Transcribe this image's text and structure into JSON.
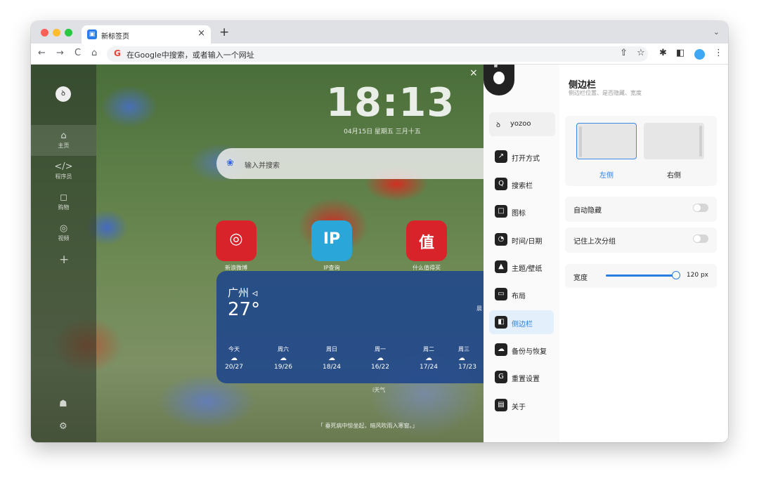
{
  "browser": {
    "tab_title": "新标签页",
    "tab_close": "×",
    "new_tab": "+",
    "tab_dropdown": "⌄",
    "back": "←",
    "forward": "→",
    "reload": "C",
    "home": "⌂",
    "google_letter": "G",
    "address_placeholder": "在Google中搜索，或者输入一个网址",
    "share": "⇧",
    "bookmark": "☆",
    "extensions": "✱",
    "sidebar_toggle": "◧",
    "menu": "⋮"
  },
  "sidebar": {
    "logo": "ꝺ",
    "items": [
      {
        "icon": "⌂",
        "label": "主页"
      },
      {
        "icon": "</>",
        "label": "程序员"
      },
      {
        "icon": "◻",
        "label": "购物"
      },
      {
        "icon": "◎",
        "label": "视频"
      }
    ],
    "add": "+",
    "bottom_icon_1": "☗",
    "bottom_icon_2": "⚙"
  },
  "main": {
    "time": "18:13",
    "close": "×",
    "date": "04月15日 星期五 三月十五",
    "search_icon": "❀",
    "search_placeholder": "输入并搜索",
    "apps": [
      {
        "label": "新浪微博",
        "icon": "◎",
        "color": "#d8232a"
      },
      {
        "label": "IP查询",
        "icon": "IP",
        "color": "#2aa6d9"
      },
      {
        "label": "什么值得买",
        "icon": "值",
        "color": "#d8232a"
      }
    ],
    "poem": "「 垂死病中惊坐起，暗风吹雨入寒窗。」"
  },
  "weather": {
    "city": "广州 ◃",
    "temp": "27°",
    "edge": "晨",
    "source": "i天气",
    "days": [
      {
        "name": "今天",
        "icon": "☁",
        "range": "20/27"
      },
      {
        "name": "周六",
        "icon": "☁",
        "range": "19/26"
      },
      {
        "name": "周日",
        "icon": "☁",
        "range": "18/24"
      },
      {
        "name": "周一",
        "icon": "☁",
        "range": "16/22"
      },
      {
        "name": "周二",
        "icon": "☁",
        "range": "17/24"
      },
      {
        "name": "周三",
        "icon": "☁",
        "range": "17/23"
      }
    ]
  },
  "settings": {
    "user_logo": "ꝺ",
    "user_name": "yozoo",
    "menu": [
      {
        "icon": "↗",
        "label": "打开方式"
      },
      {
        "icon": "Q",
        "label": "搜索栏"
      },
      {
        "icon": "□",
        "label": "图标"
      },
      {
        "icon": "◔",
        "label": "时间/日期"
      },
      {
        "icon": "▲",
        "label": "主题/壁纸"
      },
      {
        "icon": "▭",
        "label": "布局"
      },
      {
        "icon": "◧",
        "label": "侧边栏"
      },
      {
        "icon": "☁",
        "label": "备份与恢复"
      },
      {
        "icon": "G",
        "label": "重置设置"
      },
      {
        "icon": "▤",
        "label": "关于"
      }
    ],
    "title": "侧边栏",
    "subtitle": "侧边栏位置、是否隐藏、宽度",
    "position_left": "左侧",
    "position_right": "右侧",
    "auto_hide": "自动隐藏",
    "remember_group": "记住上次分组",
    "width_label": "宽度",
    "width_value": "120 px",
    "width_fraction": 0.9,
    "colors": {
      "accent": "#2a7de1",
      "panel_bg": "#ffffff"
    }
  }
}
